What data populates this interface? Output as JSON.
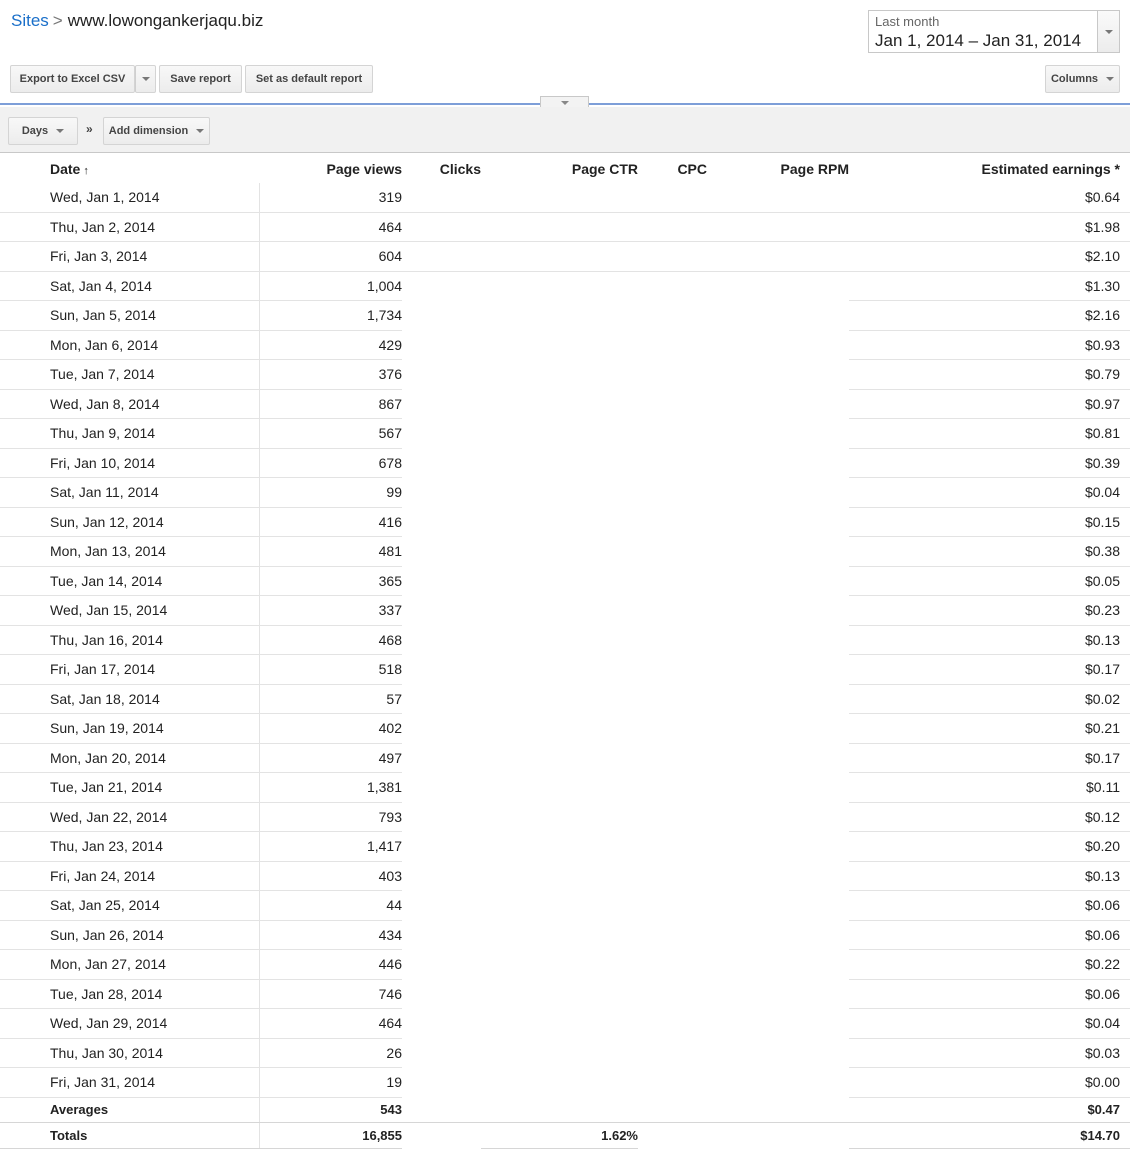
{
  "breadcrumb": {
    "parent": "Sites",
    "separator": ">",
    "current": "www.lowongankerjaqu.biz"
  },
  "date_picker": {
    "label": "Last month",
    "range": "Jan 1, 2014 – Jan 31, 2014"
  },
  "toolbar": {
    "export_label": "Export to Excel CSV",
    "save_label": "Save report",
    "default_label": "Set as default report",
    "columns_label": "Columns"
  },
  "dimensions": {
    "days_label": "Days",
    "separator": "»",
    "add_label": "Add dimension"
  },
  "table": {
    "headers": {
      "date": "Date",
      "sort_indicator": "↑",
      "page_views": "Page views",
      "clicks": "Clicks",
      "page_ctr": "Page CTR",
      "cpc": "CPC",
      "page_rpm": "Page RPM",
      "estimated_earnings": "Estimated earnings *"
    },
    "rows": [
      {
        "date": "Wed, Jan 1, 2014",
        "page_views": "319",
        "earnings": "$0.64"
      },
      {
        "date": "Thu, Jan 2, 2014",
        "page_views": "464",
        "earnings": "$1.98"
      },
      {
        "date": "Fri, Jan 3, 2014",
        "page_views": "604",
        "earnings": "$2.10"
      },
      {
        "date": "Sat, Jan 4, 2014",
        "page_views": "1,004",
        "earnings": "$1.30"
      },
      {
        "date": "Sun, Jan 5, 2014",
        "page_views": "1,734",
        "earnings": "$2.16"
      },
      {
        "date": "Mon, Jan 6, 2014",
        "page_views": "429",
        "earnings": "$0.93"
      },
      {
        "date": "Tue, Jan 7, 2014",
        "page_views": "376",
        "earnings": "$0.79"
      },
      {
        "date": "Wed, Jan 8, 2014",
        "page_views": "867",
        "earnings": "$0.97"
      },
      {
        "date": "Thu, Jan 9, 2014",
        "page_views": "567",
        "earnings": "$0.81"
      },
      {
        "date": "Fri, Jan 10, 2014",
        "page_views": "678",
        "earnings": "$0.39"
      },
      {
        "date": "Sat, Jan 11, 2014",
        "page_views": "99",
        "earnings": "$0.04"
      },
      {
        "date": "Sun, Jan 12, 2014",
        "page_views": "416",
        "earnings": "$0.15"
      },
      {
        "date": "Mon, Jan 13, 2014",
        "page_views": "481",
        "earnings": "$0.38"
      },
      {
        "date": "Tue, Jan 14, 2014",
        "page_views": "365",
        "earnings": "$0.05"
      },
      {
        "date": "Wed, Jan 15, 2014",
        "page_views": "337",
        "earnings": "$0.23"
      },
      {
        "date": "Thu, Jan 16, 2014",
        "page_views": "468",
        "earnings": "$0.13"
      },
      {
        "date": "Fri, Jan 17, 2014",
        "page_views": "518",
        "earnings": "$0.17"
      },
      {
        "date": "Sat, Jan 18, 2014",
        "page_views": "57",
        "earnings": "$0.02"
      },
      {
        "date": "Sun, Jan 19, 2014",
        "page_views": "402",
        "earnings": "$0.21"
      },
      {
        "date": "Mon, Jan 20, 2014",
        "page_views": "497",
        "earnings": "$0.17"
      },
      {
        "date": "Tue, Jan 21, 2014",
        "page_views": "1,381",
        "earnings": "$0.11"
      },
      {
        "date": "Wed, Jan 22, 2014",
        "page_views": "793",
        "earnings": "$0.12"
      },
      {
        "date": "Thu, Jan 23, 2014",
        "page_views": "1,417",
        "earnings": "$0.20"
      },
      {
        "date": "Fri, Jan 24, 2014",
        "page_views": "403",
        "earnings": "$0.13"
      },
      {
        "date": "Sat, Jan 25, 2014",
        "page_views": "44",
        "earnings": "$0.06"
      },
      {
        "date": "Sun, Jan 26, 2014",
        "page_views": "434",
        "earnings": "$0.06"
      },
      {
        "date": "Mon, Jan 27, 2014",
        "page_views": "446",
        "earnings": "$0.22"
      },
      {
        "date": "Tue, Jan 28, 2014",
        "page_views": "746",
        "earnings": "$0.06"
      },
      {
        "date": "Wed, Jan 29, 2014",
        "page_views": "464",
        "earnings": "$0.04"
      },
      {
        "date": "Thu, Jan 30, 2014",
        "page_views": "26",
        "earnings": "$0.03"
      },
      {
        "date": "Fri, Jan 31, 2014",
        "page_views": "19",
        "earnings": "$0.00"
      }
    ],
    "averages": {
      "label": "Averages",
      "page_views": "543",
      "earnings": "$0.47"
    },
    "totals": {
      "label": "Totals",
      "page_views": "16,855",
      "page_ctr": "1.62%",
      "earnings": "$14.70"
    }
  }
}
